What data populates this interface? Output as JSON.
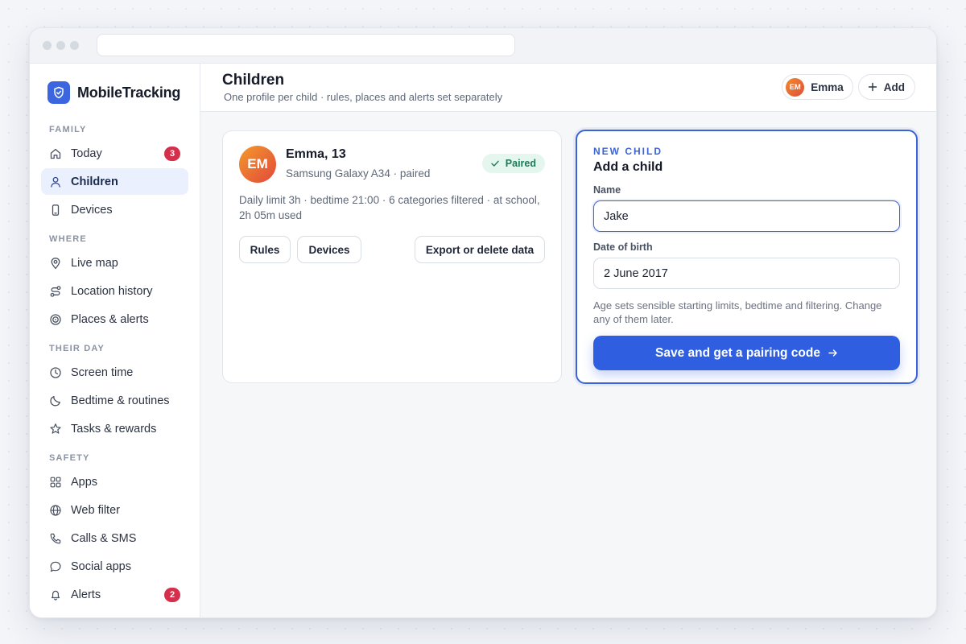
{
  "app": {
    "name": "MobileTracking"
  },
  "sidebar": {
    "sections": [
      {
        "label": "FAMILY",
        "items": [
          {
            "label": "Today",
            "icon": "home-icon",
            "badge": "3"
          },
          {
            "label": "Children",
            "icon": "user-icon",
            "active": true
          },
          {
            "label": "Devices",
            "icon": "phone-icon"
          }
        ]
      },
      {
        "label": "WHERE",
        "items": [
          {
            "label": "Live map",
            "icon": "pin-icon"
          },
          {
            "label": "Location history",
            "icon": "route-icon"
          },
          {
            "label": "Places & alerts",
            "icon": "target-icon"
          }
        ]
      },
      {
        "label": "THEIR DAY",
        "items": [
          {
            "label": "Screen time",
            "icon": "clock-icon"
          },
          {
            "label": "Bedtime & routines",
            "icon": "moon-icon"
          },
          {
            "label": "Tasks & rewards",
            "icon": "star-icon"
          }
        ]
      },
      {
        "label": "SAFETY",
        "items": [
          {
            "label": "Apps",
            "icon": "grid-icon"
          },
          {
            "label": "Web filter",
            "icon": "globe-icon"
          },
          {
            "label": "Calls & SMS",
            "icon": "phone-call-icon"
          },
          {
            "label": "Social apps",
            "icon": "chat-icon"
          },
          {
            "label": "Alerts",
            "icon": "bell-icon",
            "badge": "2"
          }
        ]
      }
    ]
  },
  "header": {
    "title": "Children",
    "subtitle": "One profile per child · rules, places and alerts set separately",
    "child_chip": {
      "initials": "EM",
      "name": "Emma"
    },
    "add_label": "Add"
  },
  "child_card": {
    "initials": "EM",
    "name": "Emma, 13",
    "device": "Samsung Galaxy A34 · paired",
    "status": "Paired",
    "summary": "Daily limit 3h · bedtime 21:00 · 6 categories filtered · at school, 2h 05m used",
    "actions": {
      "rules": "Rules",
      "devices": "Devices",
      "export": "Export or delete data"
    }
  },
  "new_child_form": {
    "eyebrow": "NEW CHILD",
    "title": "Add a child",
    "name_label": "Name",
    "name_value": "Jake",
    "dob_label": "Date of birth",
    "dob_value": "2 June 2017",
    "hint": "Age sets sensible starting limits, bedtime and filtering. Change any of them later.",
    "submit_label": "Save and get a pairing code"
  },
  "colors": {
    "accent": "#2f5fe0",
    "badge_red": "#d62f4b",
    "paired_green": "#1f7a57",
    "active_nav_bg": "#eaf0fd"
  }
}
